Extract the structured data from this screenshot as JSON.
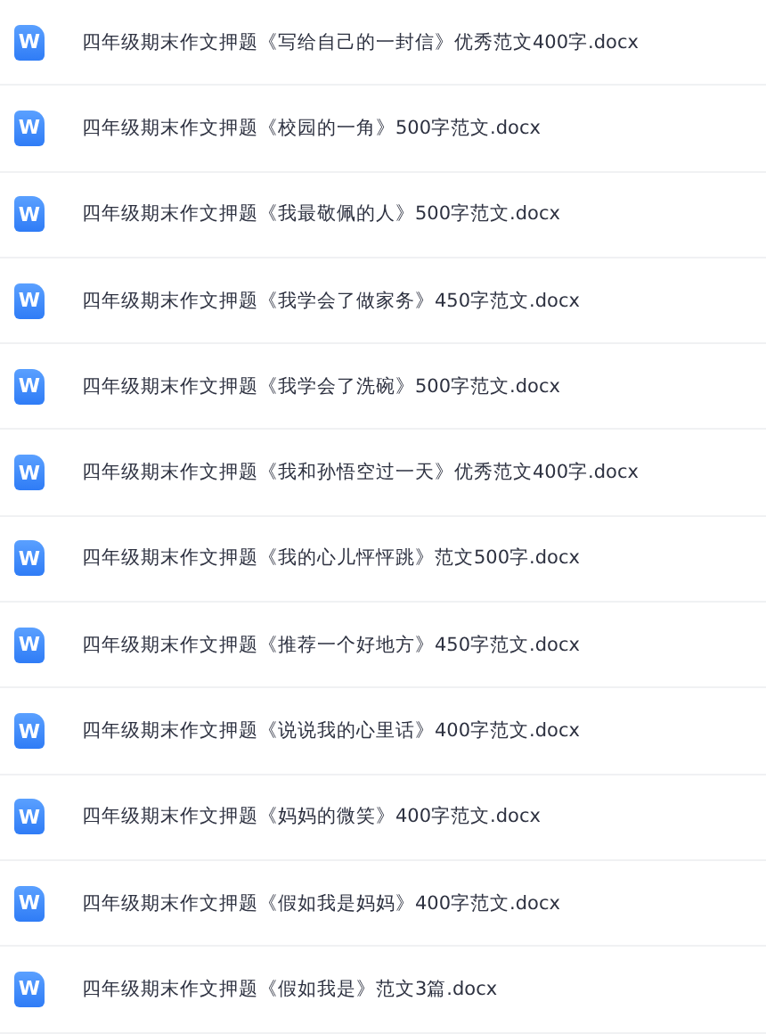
{
  "files": [
    {
      "icon_label": "W",
      "name": "四年级期末作文押题《写给自己的一封信》优秀范文400字.docx"
    },
    {
      "icon_label": "W",
      "name": "四年级期末作文押题《校园的一角》500字范文.docx"
    },
    {
      "icon_label": "W",
      "name": "四年级期末作文押题《我最敬佩的人》500字范文.docx"
    },
    {
      "icon_label": "W",
      "name": "四年级期末作文押题《我学会了做家务》450字范文.docx"
    },
    {
      "icon_label": "W",
      "name": "四年级期末作文押题《我学会了洗碗》500字范文.docx"
    },
    {
      "icon_label": "W",
      "name": "四年级期末作文押题《我和孙悟空过一天》优秀范文400字.docx"
    },
    {
      "icon_label": "W",
      "name": "四年级期末作文押题《我的心儿怦怦跳》范文500字.docx"
    },
    {
      "icon_label": "W",
      "name": "四年级期末作文押题《推荐一个好地方》450字范文.docx"
    },
    {
      "icon_label": "W",
      "name": "四年级期末作文押题《说说我的心里话》400字范文.docx"
    },
    {
      "icon_label": "W",
      "name": "四年级期末作文押题《妈妈的微笑》400字范文.docx"
    },
    {
      "icon_label": "W",
      "name": "四年级期末作文押题《假如我是妈妈》400字范文.docx"
    },
    {
      "icon_label": "W",
      "name": "四年级期末作文押题《假如我是》范文3篇.docx"
    }
  ]
}
